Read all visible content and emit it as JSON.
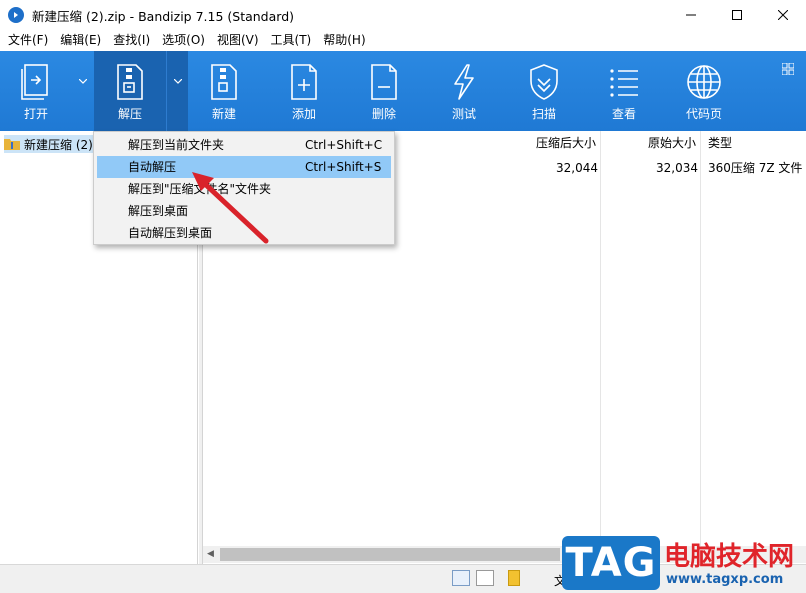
{
  "window": {
    "title": "新建压缩 (2).zip - Bandizip 7.15 (Standard)"
  },
  "menubar": {
    "items": [
      "文件(F)",
      "编辑(E)",
      "查找(I)",
      "选项(O)",
      "视图(V)",
      "工具(T)",
      "帮助(H)"
    ]
  },
  "toolbar": {
    "open": "打开",
    "extract": "解压",
    "new": "新建",
    "add": "添加",
    "delete": "删除",
    "test": "测试",
    "scan": "扫描",
    "view": "查看",
    "codepage": "代码页"
  },
  "tree": {
    "root": "新建压缩 (2)"
  },
  "filelist": {
    "columns": [
      "压缩后大小",
      "原始大小",
      "类型"
    ],
    "rows": [
      {
        "compressed": "32,044",
        "original": "32,034",
        "type": "360压缩 7Z 文件"
      }
    ]
  },
  "context_menu": {
    "items": [
      {
        "label": "解压到当前文件夹",
        "shortcut": "Ctrl+Shift+C"
      },
      {
        "label": "自动解压",
        "shortcut": "Ctrl+Shift+S"
      },
      {
        "label": "解压到\"压缩文件名\"文件夹",
        "shortcut": ""
      },
      {
        "label": "解压到桌面",
        "shortcut": ""
      },
      {
        "label": "自动解压到桌面",
        "shortcut": ""
      }
    ],
    "highlighted_index": 1
  },
  "statusbar": {
    "text": "文"
  },
  "watermark": {
    "tag": "TAG",
    "site_cn": "电脑技术网",
    "url": "www.tagxp.com"
  },
  "colors": {
    "toolbar_bg": "#2080d8",
    "menu_highlight": "#91c9f7",
    "annotation_arrow": "#d9232b"
  }
}
